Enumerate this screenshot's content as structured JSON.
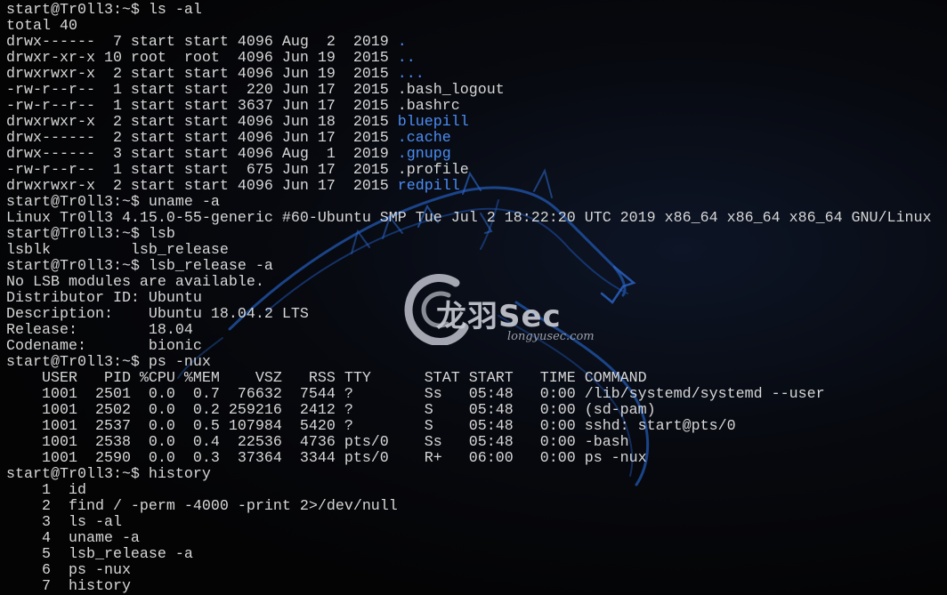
{
  "colors": {
    "background": "#050507",
    "text": "#d7d7d7",
    "directory": "#4c8df5",
    "dragon": "#1f4f9e"
  },
  "watermark": {
    "text": "龙羽Sec",
    "url": "longyusec.com"
  },
  "lines": [
    {
      "text": "start@Tr0ll3:~$ ls -al"
    },
    {
      "text": "total 40"
    },
    {
      "text": "drwx------  7 start start 4096 Aug  2  2019 ",
      "dir": "."
    },
    {
      "text": "drwxr-xr-x 10 root  root  4096 Jun 19  2015 ",
      "dir": ".."
    },
    {
      "text": "drwxrwxr-x  2 start start 4096 Jun 19  2015 ",
      "dir": "..."
    },
    {
      "text": "-rw-r--r--  1 start start  220 Jun 17  2015 .bash_logout"
    },
    {
      "text": "-rw-r--r--  1 start start 3637 Jun 17  2015 .bashrc"
    },
    {
      "text": "drwxrwxr-x  2 start start 4096 Jun 18  2015 ",
      "dir": "bluepill"
    },
    {
      "text": "drwx------  2 start start 4096 Jun 17  2015 ",
      "dir": ".cache"
    },
    {
      "text": "drwx------  3 start start 4096 Aug  1  2019 ",
      "dir": ".gnupg"
    },
    {
      "text": "-rw-r--r--  1 start start  675 Jun 17  2015 .profile"
    },
    {
      "text": "drwxrwxr-x  2 start start 4096 Jun 17  2015 ",
      "dir": "redpill"
    },
    {
      "text": "start@Tr0ll3:~$ uname -a"
    },
    {
      "text": "Linux Tr0ll3 4.15.0-55-generic #60-Ubuntu SMP Tue Jul 2 18:22:20 UTC 2019 x86_64 x86_64 x86_64 GNU/Linux"
    },
    {
      "text": "start@Tr0ll3:~$ lsb"
    },
    {
      "text": "lsblk         lsb_release"
    },
    {
      "text": "start@Tr0ll3:~$ lsb_release -a"
    },
    {
      "text": "No LSB modules are available."
    },
    {
      "text": "Distributor ID: Ubuntu"
    },
    {
      "text": "Description:    Ubuntu 18.04.2 LTS"
    },
    {
      "text": "Release:        18.04"
    },
    {
      "text": "Codename:       bionic"
    },
    {
      "text": "start@Tr0ll3:~$ ps -nux"
    },
    {
      "text": "    USER   PID %CPU %MEM    VSZ   RSS TTY      STAT START   TIME COMMAND"
    },
    {
      "text": "    1001  2501  0.0  0.7  76632  7544 ?        Ss   05:48   0:00 /lib/systemd/systemd --user"
    },
    {
      "text": "    1001  2502  0.0  0.2 259216  2412 ?        S    05:48   0:00 (sd-pam)"
    },
    {
      "text": "    1001  2537  0.0  0.5 107984  5420 ?        S    05:48   0:00 sshd: start@pts/0"
    },
    {
      "text": "    1001  2538  0.0  0.4  22536  4736 pts/0    Ss   05:48   0:00 -bash"
    },
    {
      "text": "    1001  2590  0.0  0.3  37364  3344 pts/0    R+   06:00   0:00 ps -nux"
    },
    {
      "text": "start@Tr0ll3:~$ history"
    },
    {
      "text": "    1  id"
    },
    {
      "text": "    2  find / -perm -4000 -print 2>/dev/null"
    },
    {
      "text": "    3  ls -al"
    },
    {
      "text": "    4  uname -a"
    },
    {
      "text": "    5  lsb_release -a"
    },
    {
      "text": "    6  ps -nux"
    },
    {
      "text": "    7  history"
    }
  ]
}
